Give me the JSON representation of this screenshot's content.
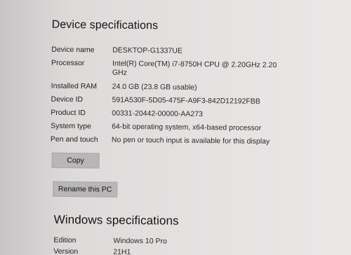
{
  "device_specifications": {
    "title": "Device specifications",
    "rows": [
      {
        "label": "Device name",
        "value": "DESKTOP-G1337UE"
      },
      {
        "label": "Processor",
        "value": "Intel(R) Core(TM) i7-8750H CPU @ 2.20GHz   2.20 GHz"
      },
      {
        "label": "Installed RAM",
        "value": "24.0 GB (23.8 GB usable)"
      },
      {
        "label": "Device ID",
        "value": "591A530F-5D05-475F-A9F3-842D12192FBB"
      },
      {
        "label": "Product ID",
        "value": "00331-20442-00000-AA273"
      },
      {
        "label": "System type",
        "value": "64-bit operating system, x64-based processor"
      },
      {
        "label": "Pen and touch",
        "value": "No pen or touch input is available for this display"
      }
    ],
    "copy_label": "Copy",
    "rename_label": "Rename this PC"
  },
  "windows_specifications": {
    "title": "Windows specifications",
    "rows": [
      {
        "label": "Edition",
        "value": "Windows 10 Pro"
      },
      {
        "label": "Version",
        "value": "21H1"
      }
    ]
  }
}
